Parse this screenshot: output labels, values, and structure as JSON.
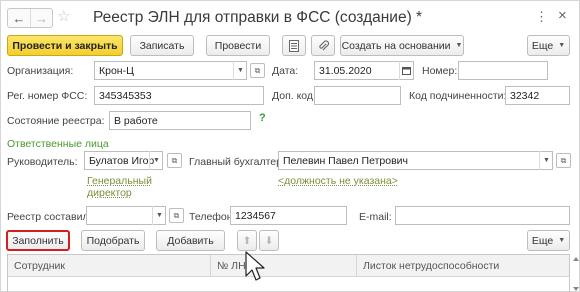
{
  "window": {
    "title": "Реестр ЭЛН для отправки в ФСС (создание) *"
  },
  "toolbar": {
    "post_and_close": "Провести и закрыть",
    "write": "Записать",
    "post": "Провести",
    "create_based_on": "Создать на основании",
    "more": "Еще"
  },
  "form": {
    "organization_label": "Организация:",
    "organization_value": "Крон-Ц",
    "date_label": "Дата:",
    "date_value": "31.05.2020",
    "number_label": "Номер:",
    "number_value": "",
    "reg_number_label": "Рег. номер ФСС:",
    "reg_number_value": "345345353",
    "extra_code_label": "Доп. код:",
    "extra_code_value": "",
    "subordination_code_label": "Код подчиненности:",
    "subordination_code_value": "32342",
    "registry_state_label": "Состояние реестра:",
    "registry_state_value": "В работе",
    "help_mark": "?"
  },
  "responsible": {
    "section_title": "Ответственные лица",
    "head_label": "Руководитель:",
    "head_value": "Булатов Игор",
    "head_position_line1": "Генеральный",
    "head_position_line2": "директор",
    "accountant_label": "Главный бухгалтер:",
    "accountant_value": "Пелевин Павел Петрович",
    "accountant_position": "<должность не указана>",
    "compiled_by_label": "Реестр составил:",
    "compiled_by_value": "",
    "phone_label": "Телефон:",
    "phone_value": "1234567",
    "email_label": "E-mail:",
    "email_value": ""
  },
  "table_toolbar": {
    "fill": "Заполнить",
    "pick": "Подобрать",
    "add": "Добавить",
    "more": "Еще"
  },
  "table": {
    "columns": [
      "Сотрудник",
      "№ ЛН",
      "Листок нетрудоспособности"
    ]
  },
  "colors": {
    "primary_button": "#f4cf2b",
    "highlight_border": "#d21f1f",
    "section_title": "#4a9a2e",
    "link": "#7a8f3c"
  }
}
